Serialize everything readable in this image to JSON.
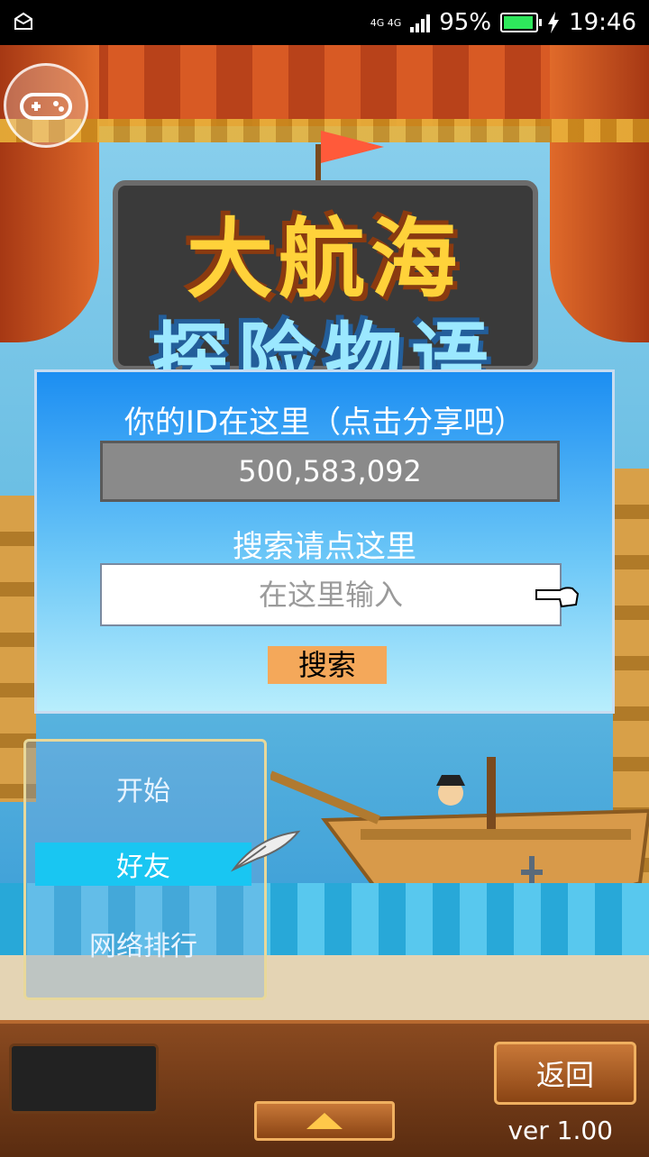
{
  "status_bar": {
    "network": "4G 4G",
    "battery_percent": "95%",
    "battery_level": 0.95,
    "time": "19:46",
    "icons": [
      "notification-icon",
      "signal-icon",
      "battery-icon",
      "charging-icon"
    ]
  },
  "game": {
    "logo_line1": "大航海",
    "logo_line2": "探险物语"
  },
  "friend_dialog": {
    "id_label": "你的ID在这里（点击分享吧）",
    "player_id": "500,583,092",
    "search_label": "搜索请点这里",
    "search_placeholder": "在这里输入",
    "search_button": "搜索"
  },
  "side_menu": {
    "items": [
      {
        "label": "开始",
        "selected": false
      },
      {
        "label": "好友",
        "selected": true
      },
      {
        "label": "网络排行",
        "selected": false
      }
    ]
  },
  "bottom_bar": {
    "back_button": "返回",
    "version": "ver 1.00"
  },
  "colors": {
    "dialog_top": "#1c8ef2",
    "dialog_bottom": "#b8eefc",
    "selected_item": "#19c6f2",
    "search_button": "#f4a85a",
    "battery_fill": "#2ee85c"
  }
}
